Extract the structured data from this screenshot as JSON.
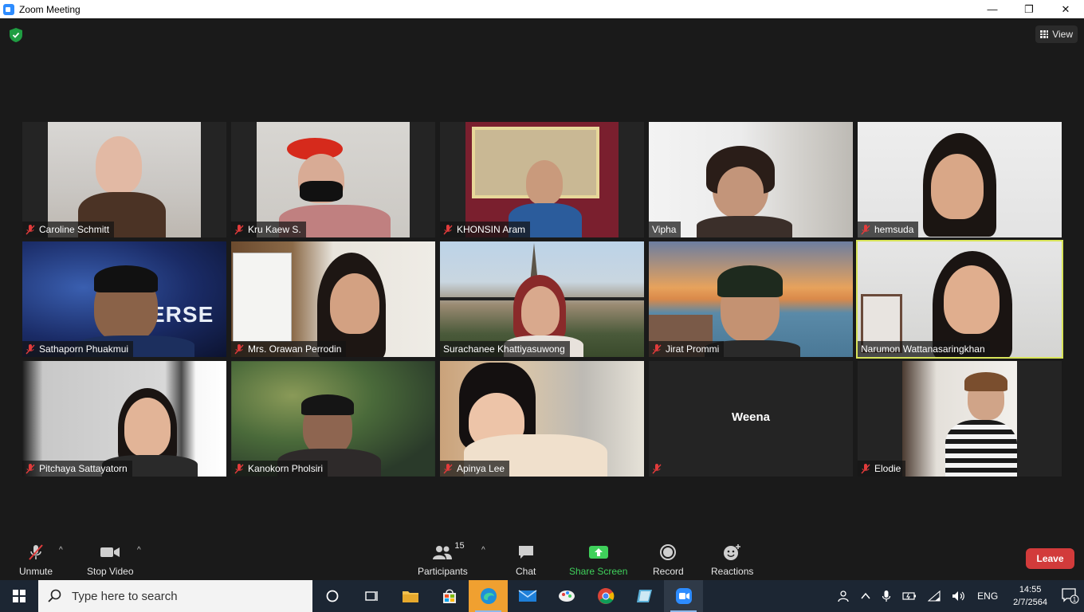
{
  "window": {
    "title": "Zoom Meeting",
    "minimize": "—",
    "maximize": "❐",
    "close": "✕"
  },
  "meeting": {
    "view_label": "View",
    "participants": [
      {
        "name": "Caroline Schmitt",
        "muted": true
      },
      {
        "name": "Kru Kaew S.",
        "muted": true
      },
      {
        "name": "KHONSIN Aram",
        "muted": true
      },
      {
        "name": "Vipha",
        "muted": false
      },
      {
        "name": "hemsuda",
        "muted": true
      },
      {
        "name": "Sathaporn Phuakmui",
        "muted": true
      },
      {
        "name": "Mrs. Orawan Perrodin",
        "muted": true
      },
      {
        "name": "Surachanee Khattiyasuwong",
        "muted": false
      },
      {
        "name": "Jirat Prommi",
        "muted": true
      },
      {
        "name": "Narumon Wattanasaringkhan",
        "muted": false,
        "active_speaker": true
      },
      {
        "name": "Pitchaya Sattayatorn",
        "muted": true
      },
      {
        "name": "Kanokorn Pholsiri",
        "muted": true
      },
      {
        "name": "Apinya Lee",
        "muted": true
      },
      {
        "name": "Weena",
        "muted": true,
        "video_off": true
      },
      {
        "name": "Elodie",
        "muted": true
      }
    ]
  },
  "toolbar": {
    "unmute": "Unmute",
    "stop_video": "Stop Video",
    "participants": "Participants",
    "participants_count": "15",
    "chat": "Chat",
    "share_screen": "Share Screen",
    "record": "Record",
    "reactions": "Reactions",
    "leave": "Leave"
  },
  "taskbar": {
    "search_placeholder": "Type here to search",
    "language": "ENG",
    "time": "14:55",
    "date": "2/7/2564",
    "notification_count": "1"
  },
  "colors": {
    "accent_green": "#3fd05b",
    "leave_red": "#d23b3b",
    "active_speaker": "#d8e45a"
  }
}
